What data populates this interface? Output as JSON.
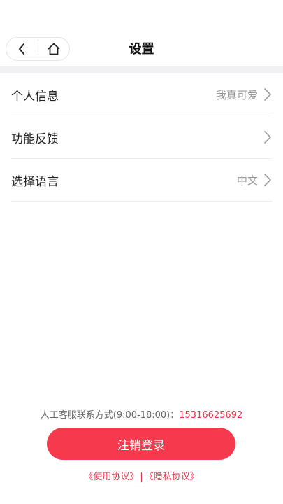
{
  "header": {
    "title": "设置",
    "back_icon": "chevron-left-icon",
    "home_icon": "home-icon"
  },
  "settings": {
    "items": [
      {
        "label": "个人信息",
        "value": "我真可爱"
      },
      {
        "label": "功能反馈",
        "value": ""
      },
      {
        "label": "选择语言",
        "value": "中文"
      }
    ]
  },
  "footer": {
    "contact_text": "人工客服联系方式(9:00-18:00)：",
    "contact_phone": "15316625692",
    "logout_label": "注销登录",
    "terms_link": "《使用协议》",
    "separator": "|",
    "privacy_link": "《隐私协议》"
  },
  "colors": {
    "accent": "#f6394d",
    "link": "#e8324a",
    "band": "#f1f1f4"
  }
}
